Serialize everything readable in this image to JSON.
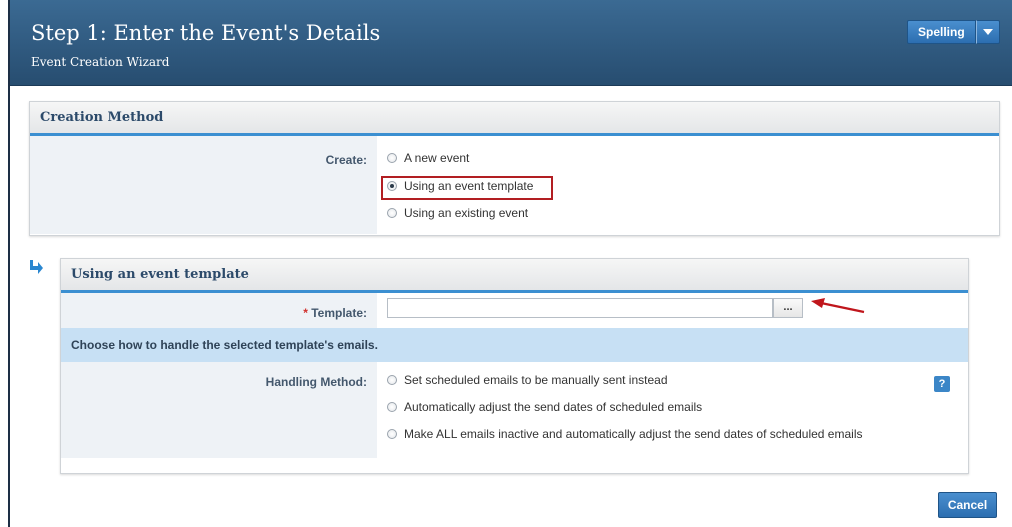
{
  "header": {
    "title": "Step 1: Enter the Event's Details",
    "subtitle": "Event Creation Wizard",
    "spelling_label": "Spelling"
  },
  "creation_method": {
    "heading": "Creation Method",
    "create_label": "Create:",
    "options": [
      {
        "label": "A new event",
        "checked": false
      },
      {
        "label": "Using an event template",
        "checked": true
      },
      {
        "label": "Using an existing event",
        "checked": false
      }
    ]
  },
  "template_section": {
    "heading": "Using an event template",
    "required_mark": "*",
    "template_label": "Template:",
    "template_value": "",
    "browse_label": "...",
    "info_text": "Choose how to handle the selected template's emails.",
    "handling_label": "Handling Method:",
    "help_label": "?",
    "handling_options": [
      {
        "label": "Set scheduled emails to be manually sent instead",
        "checked": false
      },
      {
        "label": "Automatically adjust the send dates of scheduled emails",
        "checked": false
      },
      {
        "label": "Make ALL emails inactive and automatically adjust the send dates of scheduled emails",
        "checked": false
      }
    ]
  },
  "footer": {
    "cancel_label": "Cancel"
  },
  "colors": {
    "header": "#2f5a80",
    "accent": "#3b8fd1",
    "highlight": "#b21e22",
    "info_bar": "#c7e0f4"
  }
}
